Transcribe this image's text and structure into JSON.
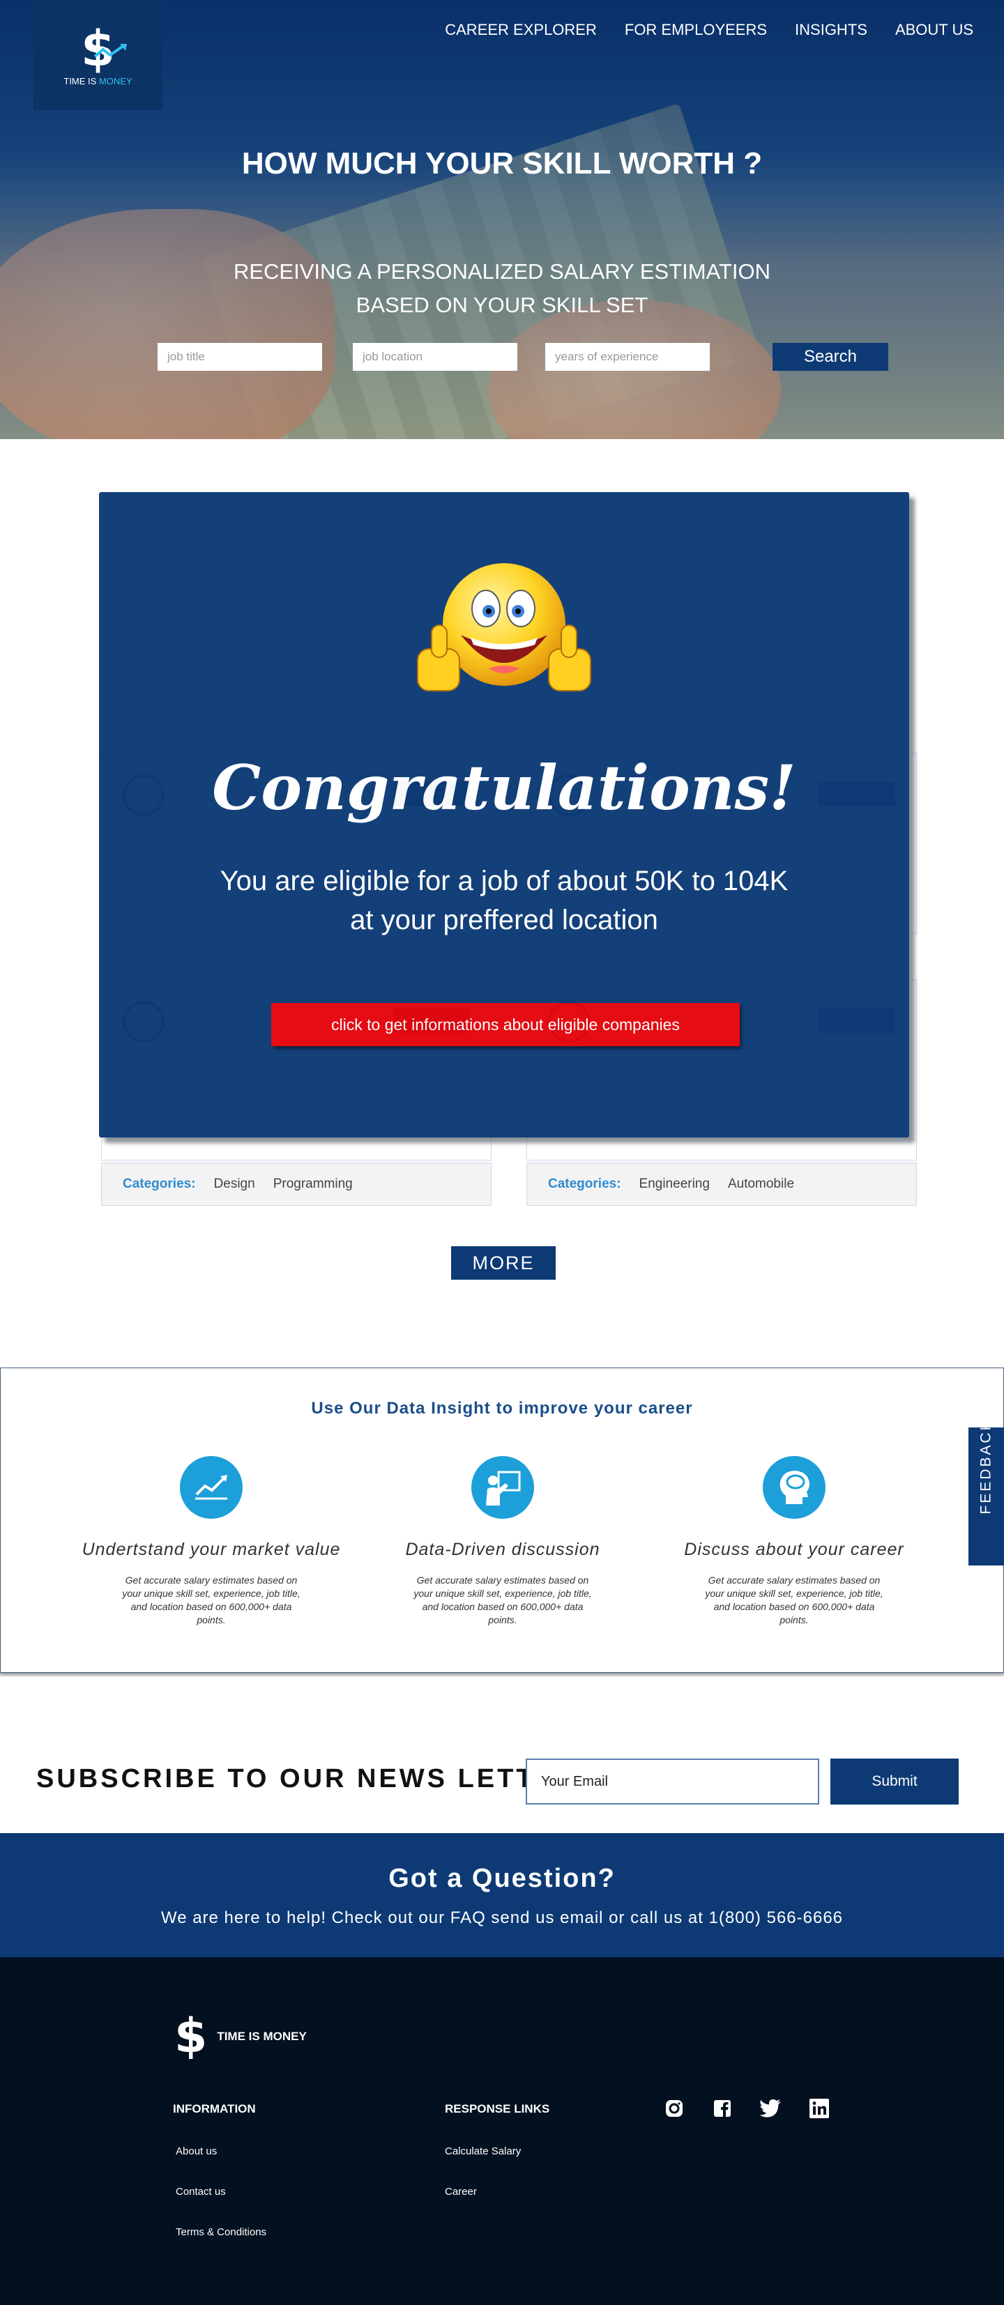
{
  "brand": {
    "logo_symbol": "$",
    "name_part1": "TIME IS ",
    "name_part2": "MONEY",
    "footer_name": "TIME IS MONEY",
    "accent": "#2ec1f2"
  },
  "nav": {
    "items": [
      "CAREER EXPLORER",
      "FOR EMPLOYEERS",
      "INSIGHTS",
      "ABOUT US"
    ]
  },
  "hero": {
    "title": "HOW MUCH YOUR SKILL WORTH ?",
    "subtitle": "RECEIVING A PERSONALIZED SALARY ESTIMATION BASED ON YOUR SKILL SET",
    "search": {
      "job_title_placeholder": "job title",
      "job_location_placeholder": "job location",
      "experience_placeholder": "years of experience",
      "button_label": "Search"
    }
  },
  "companies": {
    "cards": [
      {
        "categories_label": "Categories:",
        "categories": [
          "Design",
          "Programming"
        ]
      },
      {
        "categories_label": "Categories:",
        "categories": [
          "Engineering",
          "Automobile"
        ]
      }
    ],
    "more_label": "MORE"
  },
  "modal": {
    "title": "Congratulations!",
    "message": "You are eligible for a job of about 50K to 104K at your preffered location",
    "cta_label": "click to get informations about eligible companies"
  },
  "insight": {
    "heading": "Use Our Data Insight to improve your career",
    "features": [
      {
        "icon": "chart-icon",
        "title": "Undertstand your market value",
        "desc": "Get accurate salary estimates based on your unique skill set, experience, job title, and location based on 600,000+ data points."
      },
      {
        "icon": "presenter-icon",
        "title": "Data-Driven discussion",
        "desc": "Get accurate salary estimates based on your unique skill set, experience, job title, and location based on 600,000+ data points."
      },
      {
        "icon": "head-icon",
        "title": "Discuss about your career",
        "desc": "Get accurate salary estimates based on your unique skill set, experience, job title, and location based on 600,000+ data points."
      }
    ],
    "feedback_label": "FEEDBACK"
  },
  "newsletter": {
    "title": "SUBSCRIBE TO OUR NEWS LETTER",
    "email_placeholder": "Your Email",
    "submit_label": "Submit"
  },
  "question": {
    "title": "Got a Question?",
    "text": "We are here to help! Check out our FAQ send us email or call us at 1(800) 566-6666"
  },
  "footer": {
    "information": {
      "heading": "INFORMATION",
      "links": [
        "About us",
        "Contact us",
        "Terms & Conditions"
      ]
    },
    "response": {
      "heading": "RESPONSE LINKS",
      "links": [
        "Calculate Salary",
        "Career"
      ]
    },
    "social": [
      "instagram-icon",
      "facebook-icon",
      "twitter-icon",
      "linkedin-icon"
    ]
  },
  "colors": {
    "primary": "#0d3a75",
    "cta_red": "#e5050c",
    "footer_bg": "#03101f",
    "icon_blue": "#1d9fd9"
  }
}
